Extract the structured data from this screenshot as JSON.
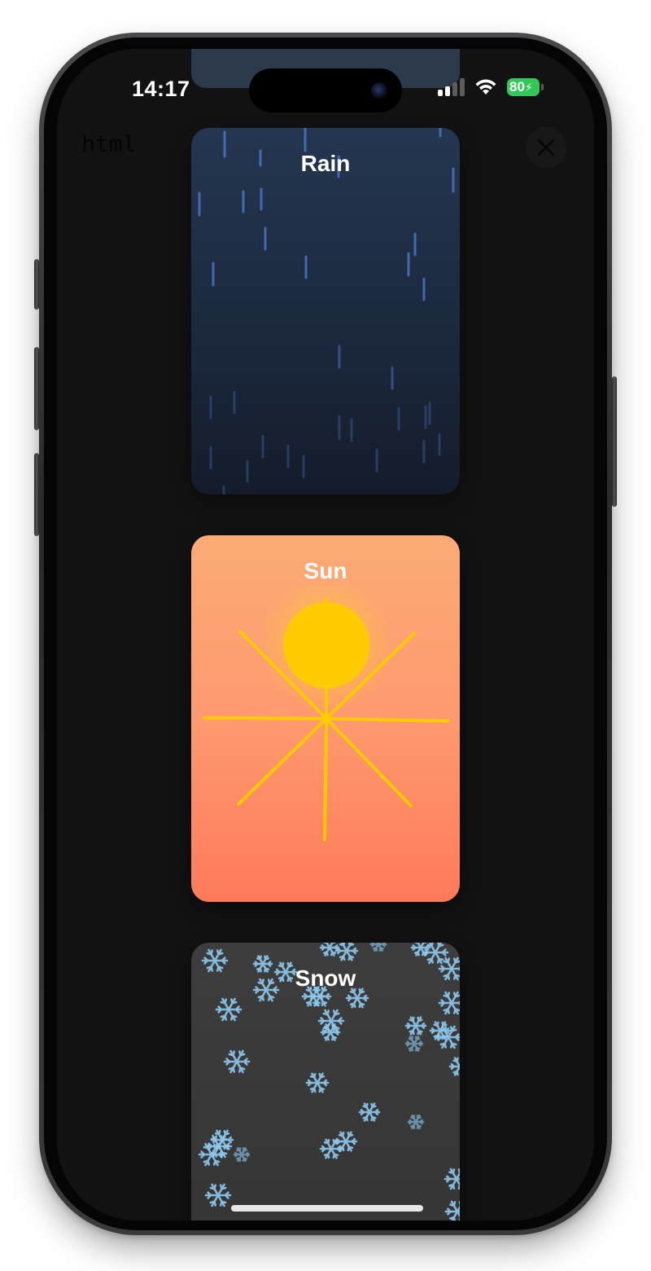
{
  "status_bar": {
    "time": "14:17",
    "battery_level": "80",
    "battery_color": "#34c759"
  },
  "header": {
    "label": "html",
    "close_icon": "close-icon"
  },
  "cards": [
    {
      "title": "Rain",
      "effect": "rain",
      "colors": [
        "#253650",
        "#141c2a"
      ],
      "accent": "#4a74c0"
    },
    {
      "title": "Sun",
      "effect": "sun",
      "colors": [
        "#fcab76",
        "#ff7a5a"
      ],
      "accent": "#ffcc00"
    },
    {
      "title": "Snow",
      "effect": "snow",
      "colors": [
        "#3d3d3d",
        "#353535"
      ],
      "accent": "#8ec9ef"
    }
  ]
}
